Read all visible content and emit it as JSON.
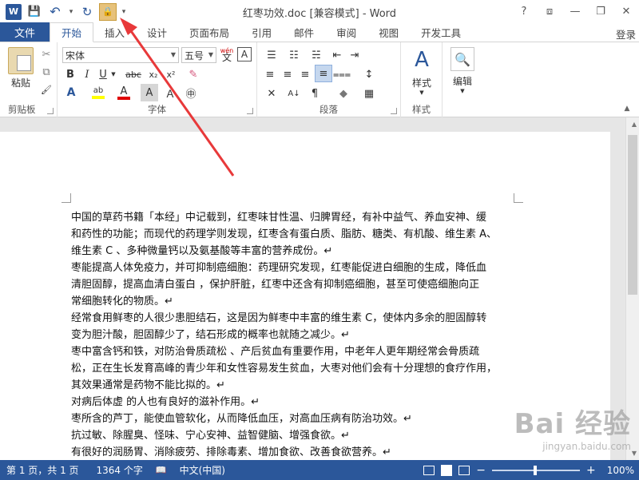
{
  "window": {
    "title": "红枣功效.doc [兼容模式] - Word",
    "help": "?",
    "ribbon_display": "⧈",
    "minimize": "—",
    "restore": "❐",
    "close": "✕"
  },
  "qat": {
    "word_logo": "W",
    "save": "💾",
    "undo": "↶",
    "undo_dropdown": "▾",
    "redo": "↻",
    "lock": "🔒",
    "customize": "▾"
  },
  "tabs": {
    "file": "文件",
    "items": [
      "开始",
      "插入",
      "设计",
      "页面布局",
      "引用",
      "邮件",
      "审阅",
      "视图",
      "开发工具"
    ],
    "login": "登录"
  },
  "ribbon": {
    "clipboard": {
      "label": "剪贴板",
      "paste": "粘贴",
      "cut": "✂",
      "copy": "⧉",
      "format_painter": "🖌"
    },
    "font": {
      "label": "字体",
      "font_name": "宋体",
      "font_size": "五号",
      "wen": "wén",
      "wen_char": "文",
      "A_box": "A",
      "grow": "A⁺",
      "shrink": "A⁻",
      "case": "Aa",
      "clear": "⌫",
      "bold": "B",
      "italic": "I",
      "underline": "U",
      "strike": "abc",
      "subscript": "x₂",
      "superscript": "x²",
      "eraser": "✎",
      "highlight": "ab",
      "font_color": "A",
      "char_shade": "A",
      "char_border": "Ａ",
      "circle": "㊥"
    },
    "paragraph": {
      "label": "段落",
      "bullets": "☰",
      "numbering": "☷",
      "multilevel": "☵",
      "decrease_indent": "⇤",
      "increase_indent": "⇥",
      "chinese_layout": "✕",
      "sort": "A↓",
      "show_marks": "¶",
      "align_left": "≡",
      "align_center": "≡",
      "align_right": "≡",
      "justify": "≡",
      "distributed": "⩶",
      "line_spacing": "↕",
      "shading": "◆",
      "borders": "▦"
    },
    "styles": {
      "label": "样式",
      "button": "样式",
      "icon": "A"
    },
    "editing": {
      "button": "编辑",
      "icon": "🔍"
    }
  },
  "document": {
    "paragraphs": [
      [
        "中国的草药书籍「本经」中记载到，红枣味甘性温、归脾胃经，有补中益气、养血安神、缓",
        "和药性的功能；而现代的药理学则发现，红枣含有蛋白质、脂肪、糖类、有机酸、维生素 A、",
        "维生素 C 、多种微量钙以及氨基酸等丰富的营养成份。↵"
      ],
      [
        "枣能提高人体免疫力，并可抑制癌细胞：药理研究发现，红枣能促进白细胞的生成，降低血",
        "清胆固醇，提高血清白蛋白 ，保护肝脏，红枣中还含有抑制癌细胞，甚至可使癌细胞向正",
        "常细胞转化的物质。↵"
      ],
      [
        "经常食用鲜枣的人很少患胆结石，这是因为鲜枣中丰富的维生素 C，使体内多余的胆固醇转",
        "变为胆汁酸，胆固醇少了，结石形成的概率也就随之减少。↵"
      ],
      [
        "枣中富含钙和铁，对防治骨质疏松 、产后贫血有重要作用，中老年人更年期经常会骨质疏",
        "松，正在生长发育高峰的青少年和女性容易发生贫血，大枣对他们会有十分理想的食疗作用，",
        "其效果通常是药物不能比拟的。↵"
      ],
      [
        "对病后体虚 的人也有良好的滋补作用。↵"
      ],
      [
        "枣所含的芦丁，能使血管软化，从而降低血压，对高血压病有防治功效。↵"
      ],
      [
        "抗过敏、除腥臭、怪味、宁心安神、益智健脑、增强食欲。↵"
      ],
      [
        "有很好的润肠胃、消除疲劳、排除毒素、增加食欲、改善食欲营养。↵"
      ]
    ]
  },
  "watermark": {
    "main": "Bai 经验",
    "sub": "jingyan.baidu.com"
  },
  "status": {
    "page": "第 1 页，共 1 页",
    "words": "1364 个字",
    "proof_icon": "📖",
    "language": "中文(中国)",
    "zoom": "100%",
    "zoom_minus": "−",
    "zoom_plus": "+"
  }
}
